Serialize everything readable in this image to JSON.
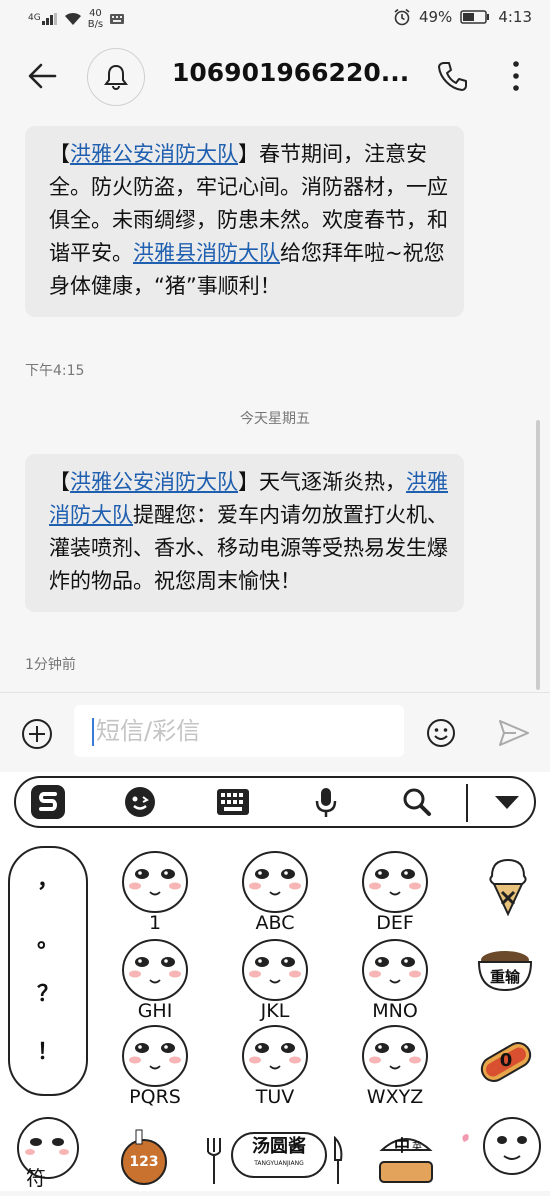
{
  "status": {
    "network": "4G",
    "speed_value": "40",
    "speed_unit": "B/s",
    "battery": "49%",
    "time": "4:13",
    "battery_level": 0.49
  },
  "header": {
    "title": "106901966220..."
  },
  "messages": [
    {
      "parts": [
        {
          "t": "【",
          "link": false
        },
        {
          "t": "洪雅公安消防大队",
          "link": true
        },
        {
          "t": "】春节期间，注意安全。防火防盗，牢记心间。消防器材，一应俱全。未雨绸缪，防患未然。欢度春节，和谐平安。",
          "link": false
        },
        {
          "t": "洪雅县消防大队",
          "link": true
        },
        {
          "t": "给您拜年啦~祝您身体健康，“猪”事顺利！",
          "link": false
        }
      ],
      "time": "下午4:15"
    },
    {
      "parts": [
        {
          "t": "【",
          "link": false
        },
        {
          "t": "洪雅公安消防大队",
          "link": true
        },
        {
          "t": "】天气逐渐炎热，",
          "link": false
        },
        {
          "t": "洪雅消防大队",
          "link": true
        },
        {
          "t": "提醒您：爱车内请勿放置打火机、灌装喷剂、香水、移动电源等受热易发生爆炸的物品。祝您周末愉快！",
          "link": false
        }
      ],
      "time": "1分钟前"
    }
  ],
  "day_separator": "今天星期五",
  "composer": {
    "placeholder": "短信/彩信"
  },
  "keyboard": {
    "punctuation": [
      "，",
      "。",
      "？",
      "！"
    ],
    "keys": [
      {
        "label": "1"
      },
      {
        "label": "ABC"
      },
      {
        "label": "DEF"
      },
      {
        "label": "GHI"
      },
      {
        "label": "JKL"
      },
      {
        "label": "MNO"
      },
      {
        "label": "PQRS"
      },
      {
        "label": "TUV"
      },
      {
        "label": "WXYZ"
      }
    ],
    "side": {
      "backspace_label": "重输",
      "zero_label": "0"
    },
    "bottom": {
      "symbols_label": "符",
      "numbers_label": "123",
      "space_label": "汤圆酱",
      "space_sub": "TANGYUANJIANG",
      "lang_label": "中",
      "lang_sub": "英"
    }
  }
}
